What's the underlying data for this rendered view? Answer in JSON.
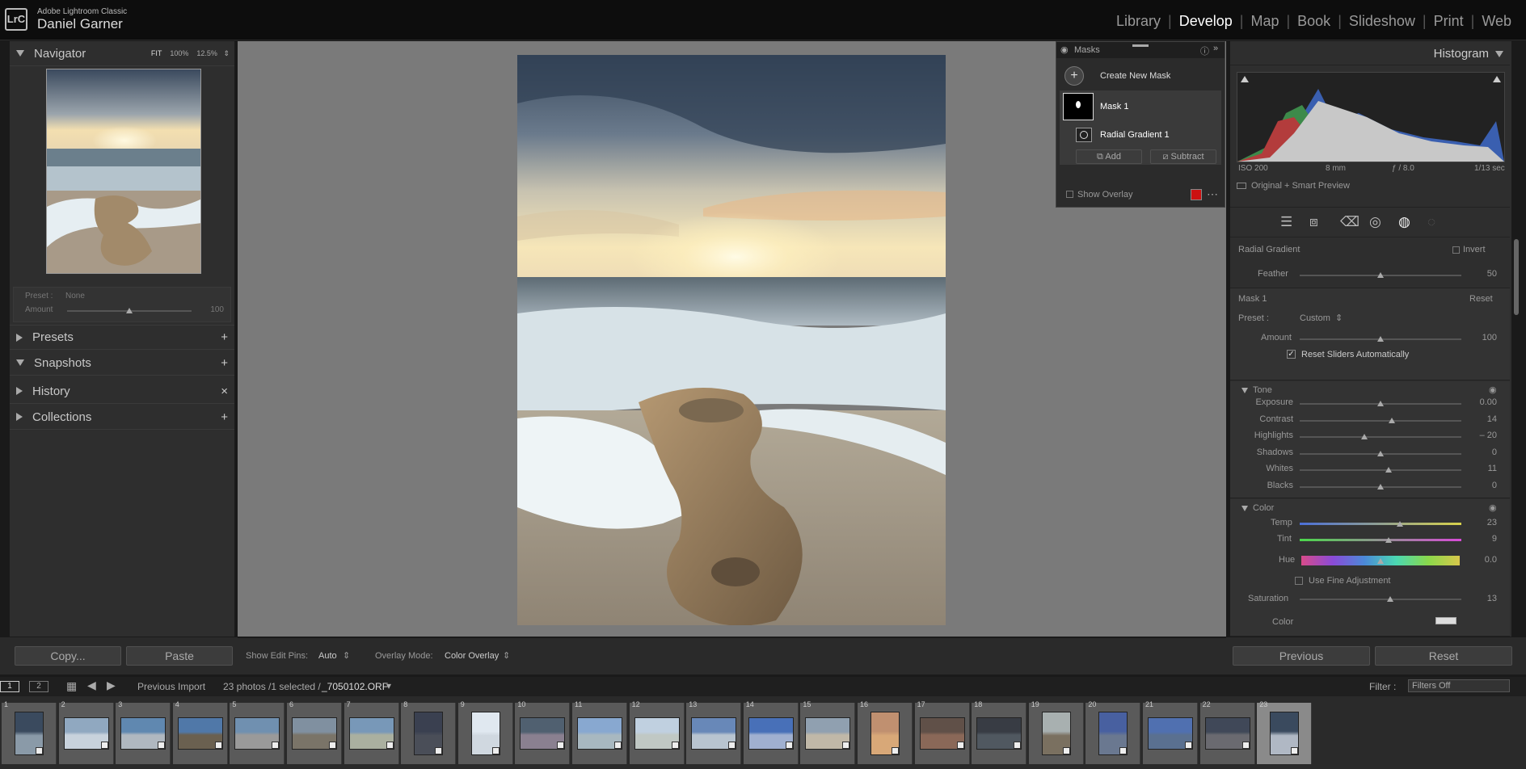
{
  "app": {
    "logo": "LrC",
    "name": "Adobe Lightroom Classic",
    "user": "Daniel Garner"
  },
  "modules": [
    {
      "label": "Library",
      "active": false
    },
    {
      "label": "Develop",
      "active": true
    },
    {
      "label": "Map",
      "active": false
    },
    {
      "label": "Book",
      "active": false
    },
    {
      "label": "Slideshow",
      "active": false
    },
    {
      "label": "Print",
      "active": false
    },
    {
      "label": "Web",
      "active": false
    }
  ],
  "navigator": {
    "title": "Navigator",
    "fit": "FIT",
    "z100": "100%",
    "z125": "12.5%"
  },
  "preset": {
    "label": "Preset :",
    "value": "None",
    "amount_label": "Amount",
    "amount_value": "100",
    "amount_fraction": 0.5
  },
  "left_panels": [
    {
      "label": "Presets",
      "action": "+"
    },
    {
      "label": "Snapshots",
      "action": "+"
    },
    {
      "label": "History",
      "action": "×"
    },
    {
      "label": "Collections",
      "action": "+"
    }
  ],
  "left_buttons": {
    "copy": "Copy...",
    "paste": "Paste"
  },
  "toolbar": {
    "pins_label": "Show Edit Pins:",
    "pins_value": "Auto",
    "overlay_label": "Overlay Mode:",
    "overlay_value": "Color Overlay"
  },
  "masks": {
    "title": "Masks",
    "create": "Create New Mask",
    "mask_name": "Mask 1",
    "component": "Radial Gradient 1",
    "add": "Add",
    "subtract": "Subtract",
    "show_overlay": "Show Overlay",
    "overlay_color": "#cc1111"
  },
  "histogram": {
    "title": "Histogram",
    "iso": "ISO 200",
    "focal": "8 mm",
    "aperture": "ƒ / 8.0",
    "shutter": "1/13 sec",
    "preview": "Original + Smart Preview"
  },
  "radial": {
    "title": "Radial Gradient",
    "invert": "Invert",
    "feather_label": "Feather",
    "feather_value": "50",
    "feather_fraction": 0.5
  },
  "mask_section": {
    "title": "Mask 1",
    "reset": "Reset",
    "preset_label": "Preset :",
    "preset_value": "Custom",
    "amount_label": "Amount",
    "amount_value": "100",
    "reset_sliders": "Reset Sliders Automatically"
  },
  "tone": {
    "title": "Tone",
    "sliders": [
      {
        "label": "Exposure",
        "value": "0.00",
        "fraction": 0.5
      },
      {
        "label": "Contrast",
        "value": "14",
        "fraction": 0.57
      },
      {
        "label": "Highlights",
        "value": "– 20",
        "fraction": 0.4
      },
      {
        "label": "Shadows",
        "value": "0",
        "fraction": 0.5
      },
      {
        "label": "Whites",
        "value": "11",
        "fraction": 0.55
      },
      {
        "label": "Blacks",
        "value": "0",
        "fraction": 0.5
      }
    ]
  },
  "color": {
    "title": "Color",
    "temp": {
      "label": "Temp",
      "value": "23",
      "fraction": 0.62
    },
    "tint": {
      "label": "Tint",
      "value": "9",
      "fraction": 0.55
    },
    "hue": {
      "label": "Hue",
      "value": "0.0",
      "fraction": 0.5
    },
    "fine": "Use Fine Adjustment",
    "saturation": {
      "label": "Saturation",
      "value": "13",
      "fraction": 0.56
    },
    "color_label": "Color"
  },
  "right_buttons": {
    "previous": "Previous",
    "reset": "Reset"
  },
  "filmstrip": {
    "view1": "1",
    "view2": "2",
    "source": "Previous Import",
    "count": "23 photos /1 selected /",
    "file": "_7050102.ORF",
    "filter_label": "Filter :",
    "filter_value": "Filters Off",
    "cells": [
      "1",
      "2",
      "3",
      "4",
      "5",
      "6",
      "7",
      "8",
      "9",
      "10",
      "11",
      "12",
      "13",
      "14",
      "15",
      "16",
      "17",
      "18",
      "19",
      "20",
      "21",
      "22",
      "23"
    ],
    "selected": 23
  }
}
